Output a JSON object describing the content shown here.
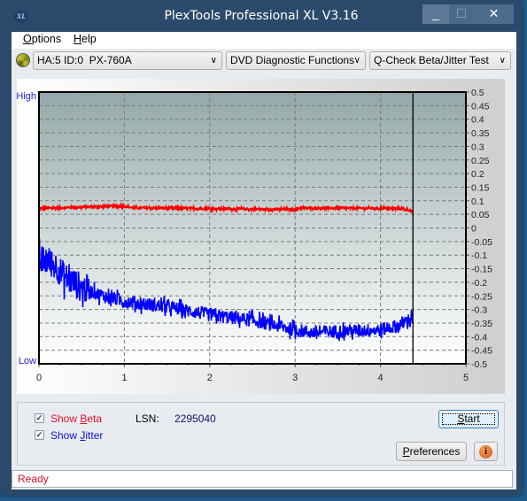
{
  "window": {
    "title": "PlexTools Professional XL V3.16",
    "app_icon_text": "XL",
    "controls": {
      "minimize": "_",
      "maximize": "☐",
      "close": "✕"
    }
  },
  "menu": {
    "items": [
      {
        "label": "Options",
        "accel": "O",
        "rest": "ptions"
      },
      {
        "label": "Help",
        "accel": "H",
        "rest": "elp"
      }
    ]
  },
  "toolbar": {
    "drive_icon": "disc-icon",
    "drive_select": "HA:5 ID:0  PX-760A",
    "function_select": "DVD Diagnostic Functions",
    "test_select": "Q-Check Beta/Jitter Test"
  },
  "chart_data": {
    "type": "line",
    "title": "",
    "xlabel": "",
    "ylabel": "",
    "y_left_labels": {
      "top": "High",
      "bottom": "Low"
    },
    "xlim": [
      0,
      5
    ],
    "ylim": [
      -0.5,
      0.5
    ],
    "x_ticks": [
      0,
      1,
      2,
      3,
      4,
      5
    ],
    "y_ticks": [
      "0.5",
      "0.45",
      "0.4",
      "0.35",
      "0.3",
      "0.25",
      "0.2",
      "0.15",
      "0.1",
      "0.05",
      "0",
      "-0.05",
      "-0.1",
      "-0.15",
      "-0.2",
      "-0.25",
      "-0.3",
      "-0.35",
      "-0.4",
      "-0.45",
      "-0.5"
    ],
    "grid": true,
    "end_marker_x": 4.38,
    "series": [
      {
        "name": "Beta",
        "color": "#ff0000",
        "noise": 0.004,
        "x": [
          0,
          0.25,
          0.5,
          0.75,
          1.0,
          1.1,
          1.5,
          2.0,
          2.5,
          3.0,
          3.05,
          3.5,
          4.0,
          4.25,
          4.35,
          4.38
        ],
        "y": [
          0.072,
          0.074,
          0.077,
          0.079,
          0.08,
          0.074,
          0.073,
          0.071,
          0.069,
          0.068,
          0.073,
          0.073,
          0.072,
          0.071,
          0.065,
          0.058
        ]
      },
      {
        "name": "Jitter",
        "color": "#0000ff",
        "noise": 0.025,
        "x": [
          0,
          0.1,
          0.2,
          0.3,
          0.5,
          0.75,
          1.0,
          1.5,
          2.0,
          2.5,
          3.0,
          3.2,
          3.5,
          4.0,
          4.2,
          4.38
        ],
        "y": [
          -0.12,
          -0.12,
          -0.14,
          -0.18,
          -0.22,
          -0.25,
          -0.27,
          -0.29,
          -0.32,
          -0.34,
          -0.375,
          -0.385,
          -0.38,
          -0.375,
          -0.36,
          -0.33
        ]
      }
    ]
  },
  "controls": {
    "show_beta": {
      "label_pre": "Show ",
      "accel": "B",
      "label_post": "eta",
      "checked": true,
      "color": "#e0102a"
    },
    "show_jitter": {
      "label_pre": "Show ",
      "accel": "J",
      "label_post": "itter",
      "checked": true,
      "color": "#1010e0"
    },
    "lsn_label": "LSN:",
    "lsn_value": "2295040",
    "start_button": {
      "accel": "S",
      "rest": "tart"
    },
    "preferences_button": {
      "accel": "P",
      "rest": "references"
    },
    "info_icon": "i"
  },
  "status": {
    "text": "Ready"
  }
}
